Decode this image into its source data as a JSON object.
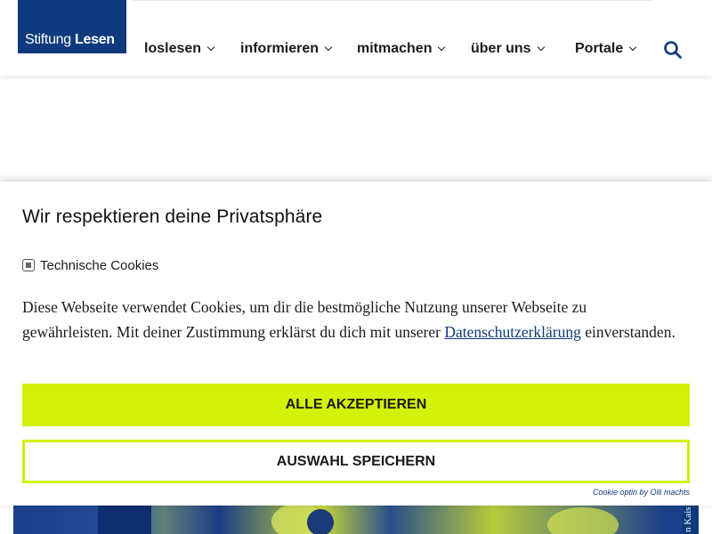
{
  "header": {
    "logo": {
      "part1": "Stiftung",
      "part2": "Lesen"
    },
    "nav": [
      {
        "label": "loslesen"
      },
      {
        "label": "informieren"
      },
      {
        "label": "mitmachen"
      },
      {
        "label": "über uns"
      },
      {
        "label": "Portale"
      }
    ],
    "search_icon": "search-icon"
  },
  "cookie_banner": {
    "title": "Wir respektieren deine Privatsphäre",
    "category_label": "Technische Cookies",
    "text_before_link": "Diese Webseite verwendet Cookies, um dir die bestmögliche Nutzung unserer Webseite zu gewährleisten. Mit deiner Zustimmung erklärst du dich mit unserer ",
    "link_text": "Datenschutzerklärung",
    "text_after_link": " einverstanden.",
    "accept_all_label": "ALLE AKZEPTIEREN",
    "save_selection_label": "AUSWAHL SPEICHERN",
    "credit": "Cookie optin by Olli machts"
  },
  "hero": {
    "photo_credit": "n Kais"
  },
  "colors": {
    "brand_blue": "#0f3a7d",
    "accent_lime": "#d2f20a"
  }
}
